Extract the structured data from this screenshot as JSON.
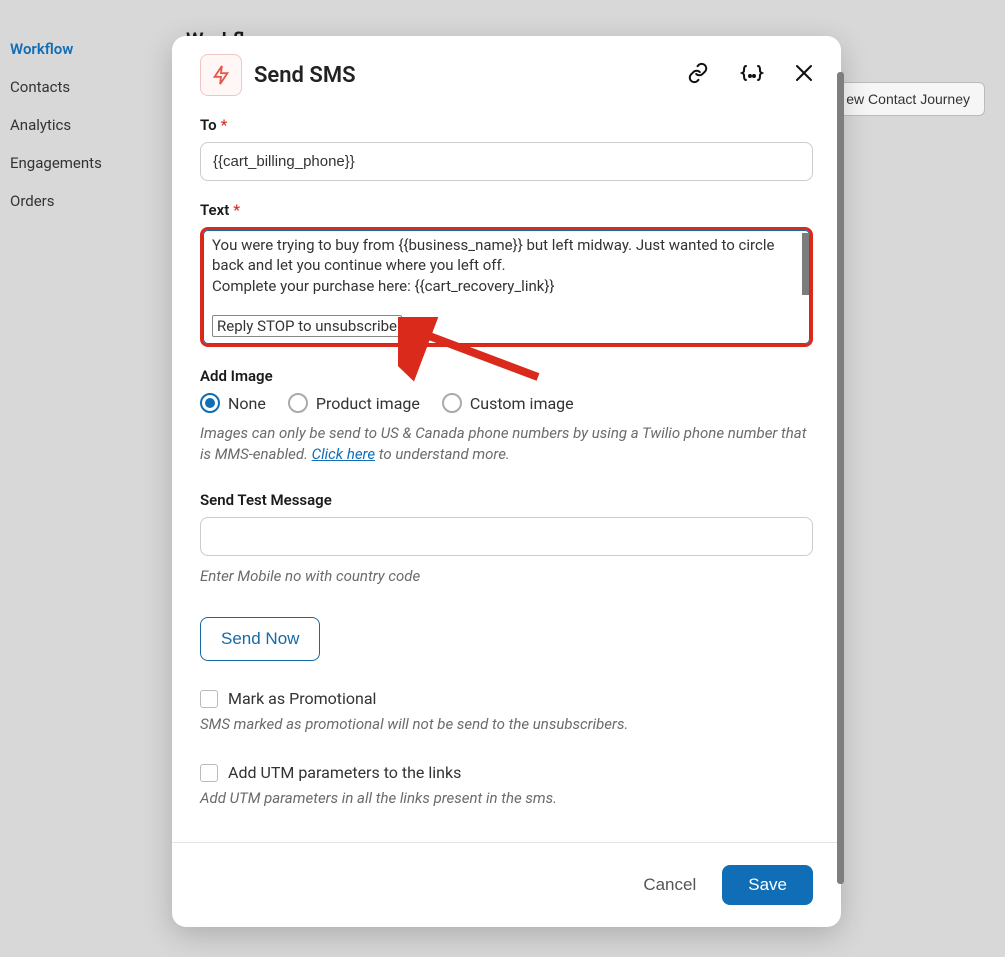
{
  "sidebar": {
    "items": [
      {
        "label": "Workflow",
        "active": true
      },
      {
        "label": "Contacts",
        "active": false
      },
      {
        "label": "Analytics",
        "active": false
      },
      {
        "label": "Engagements",
        "active": false
      },
      {
        "label": "Orders",
        "active": false
      }
    ]
  },
  "page": {
    "title_bg": "Workflow",
    "preview_btn": "ew Contact Journey"
  },
  "modal": {
    "title": "Send SMS",
    "to": {
      "label": "To",
      "value": "{{cart_billing_phone}}"
    },
    "text": {
      "label": "Text",
      "value_line1": "You were trying to buy from {{business_name}} but left midway. Just wanted to circle back and let you continue where you left off.",
      "value_line2": "Complete your purchase here: {{cart_recovery_link}}",
      "stop": "Reply STOP to unsubscribe"
    },
    "add_image": {
      "label": "Add Image",
      "options": [
        {
          "label": "None",
          "checked": true
        },
        {
          "label": "Product image",
          "checked": false
        },
        {
          "label": "Custom image",
          "checked": false
        }
      ],
      "hint_prefix": "Images can only be send to US & Canada phone numbers by using a Twilio phone number that is MMS-enabled. ",
      "hint_link": "Click here",
      "hint_suffix": " to understand more."
    },
    "test": {
      "label": "Send Test Message",
      "hint": "Enter Mobile no with country code"
    },
    "send_now": "Send Now",
    "promo": {
      "label": "Mark as Promotional",
      "hint": "SMS marked as promotional will not be send to the unsubscribers."
    },
    "utm": {
      "label": "Add UTM parameters to the links",
      "hint": "Add UTM parameters in all the links present in the sms."
    },
    "footer": {
      "cancel": "Cancel",
      "save": "Save"
    }
  }
}
